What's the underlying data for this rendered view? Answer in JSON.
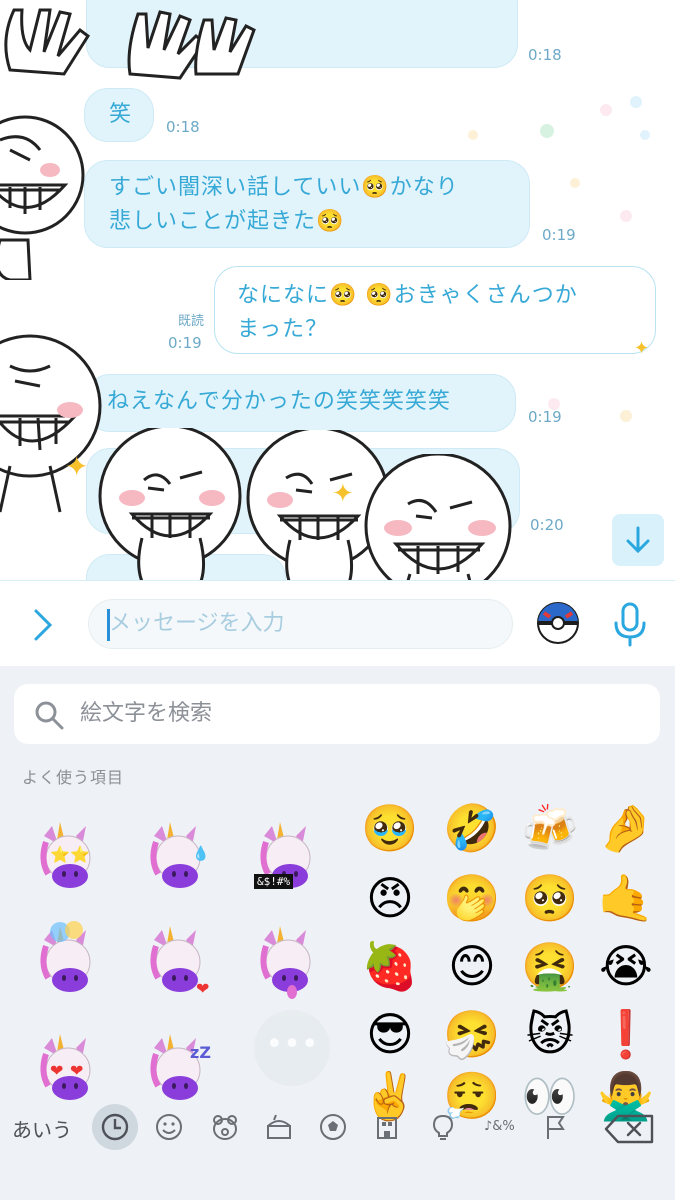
{
  "chat": {
    "messages": [
      {
        "side": "in",
        "text": "笑",
        "time": "0:18"
      },
      {
        "side": "in",
        "text_lines": [
          "すごい闇深い話していい🥺かなり",
          "悲しいことが起きた🥺"
        ],
        "time": "0:19"
      },
      {
        "side": "out",
        "text_lines": [
          "なになに🥺 🥺おきゃくさんつか",
          "まった？"
        ],
        "read": "既読",
        "time": "0:19"
      },
      {
        "side": "in",
        "text": "ねえなんで分かったの笑笑笑笑笑",
        "time": "0:19"
      },
      {
        "side": "in",
        "text": "",
        "time": "0:20"
      }
    ],
    "top_time": "0:18"
  },
  "input_bar": {
    "placeholder": "メッセージを入力"
  },
  "keyboard": {
    "search_placeholder": "絵文字を検索",
    "section_label": "よく使う項目",
    "memoji_badge": "&$!#%",
    "emoji_grid": [
      "🥹",
      "🤣",
      "🍻",
      "🤌",
      "😠",
      "🤭",
      "🥺",
      "🤙",
      "🍓",
      "😊",
      "🤮",
      "😭",
      "😎",
      "🤧",
      "😾",
      "❗",
      "✌️",
      "😮‍💨",
      "👀",
      "🙅‍♂️"
    ],
    "more_label": "•••",
    "kana_label": "あいう",
    "categories": [
      "recent-icon",
      "smiley-icon",
      "animal-icon",
      "food-icon",
      "ball-icon",
      "building-icon",
      "bulb-icon",
      "symbols-icon",
      "flag-icon"
    ],
    "symbols_label": "♪&%"
  },
  "colors": {
    "accent": "#37a9d6",
    "bubble_in": "#e2f4fb",
    "keyboard_bg": "#eef2f6"
  }
}
